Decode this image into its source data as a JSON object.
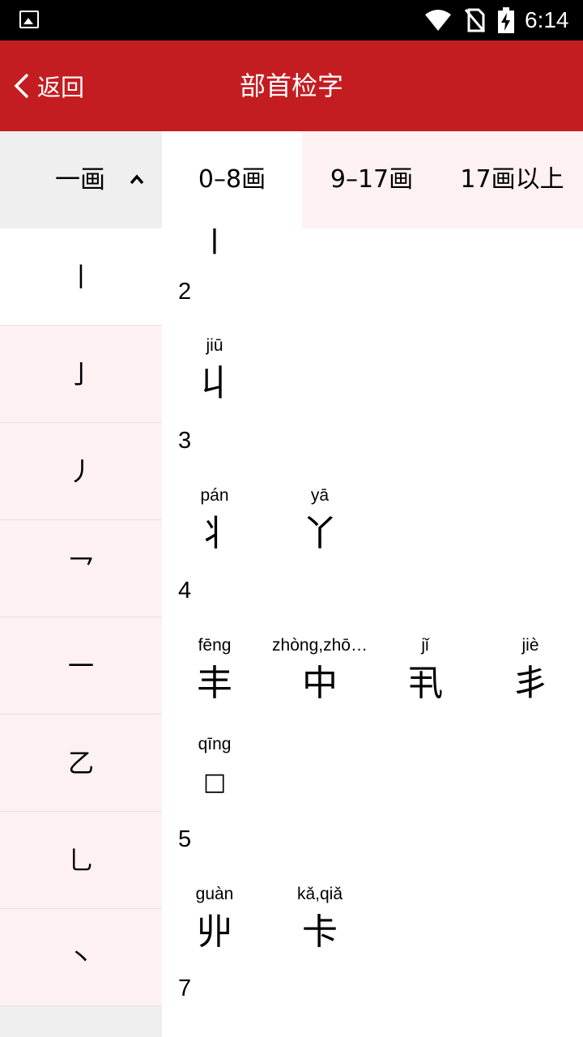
{
  "status_bar": {
    "time": "6:14"
  },
  "header": {
    "back_label": "返回",
    "title": "部首检字"
  },
  "stroke_selector": {
    "label": "一画"
  },
  "radicals": [
    "丨",
    "亅",
    "丿",
    "乛",
    "一",
    "乙",
    "乚",
    "丶"
  ],
  "active_radical_index": 0,
  "tabs": [
    "0–8画",
    "9–17画",
    "17画以上"
  ],
  "active_tab_index": 0,
  "top_char": "丨",
  "groups": [
    {
      "strokes": "2",
      "chars": [
        {
          "pinyin": "jiū",
          "char": "丩"
        }
      ]
    },
    {
      "strokes": "3",
      "chars": [
        {
          "pinyin": "pán",
          "char": "丬"
        },
        {
          "pinyin": "yā",
          "char": "丫"
        }
      ]
    },
    {
      "strokes": "4",
      "chars": [
        {
          "pinyin": "fēng",
          "char": "丰"
        },
        {
          "pinyin": "zhòng,zhō…",
          "char": "中"
        },
        {
          "pinyin": "jǐ",
          "char": "丮"
        },
        {
          "pinyin": "jiè",
          "char": "丯"
        },
        {
          "pinyin": "qīng",
          "char": "□"
        }
      ]
    },
    {
      "strokes": "5",
      "chars": [
        {
          "pinyin": "guàn",
          "char": "丱"
        },
        {
          "pinyin": "kǎ,qiǎ",
          "char": "卡"
        }
      ]
    },
    {
      "strokes": "7",
      "chars": []
    }
  ],
  "icons": {
    "status": [
      "image-icon",
      "wifi-icon",
      "no-sim-icon",
      "battery-charging-icon"
    ],
    "back": "chevron-left-icon",
    "collapse": "chevron-up-icon"
  },
  "colors": {
    "header_bg": "#c41d21",
    "tab_bg": "#fdf1f1",
    "left_bg": "#efefef"
  }
}
